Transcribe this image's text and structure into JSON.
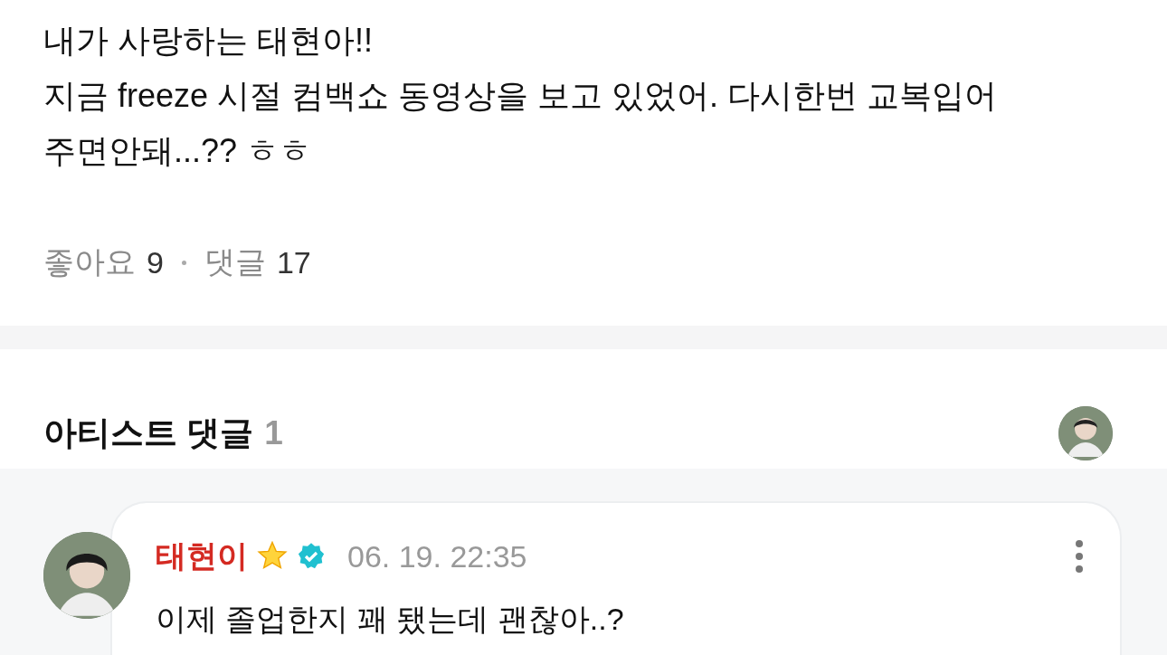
{
  "post": {
    "paragraphs": [
      "내가 사랑하는 태현아!!",
      "지금 freeze 시절 컴백쇼 동영상을 보고 있었어. 다시한번 교복입어 주면안돼...?? ㅎㅎ"
    ],
    "stats": [
      {
        "label": "좋아요",
        "count": "9"
      },
      {
        "label": "댓글",
        "count": "17"
      }
    ]
  },
  "artist_comments": {
    "title": "아티스트 댓글",
    "count": "1",
    "comments": [
      {
        "author": "태현이",
        "verified": true,
        "date": "06. 19. 22:35",
        "text": "이제 졸업한지 꽤 됐는데 괜찮아..?"
      }
    ]
  }
}
